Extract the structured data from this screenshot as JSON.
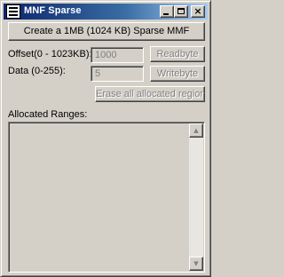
{
  "window": {
    "title": "MNF Sparse",
    "app_icon": "document-icon",
    "controls": {
      "minimize": "minimize-icon",
      "maximize": "maximize-icon",
      "close": "close-icon",
      "close_glyph": "×"
    }
  },
  "buttons": {
    "create_label": "Create a 1MB (1024 KB) Sparse MMF",
    "readbyte_label": "Readbyte",
    "writebyte_label": "Writebyte",
    "erase_label": "Erase all allocated regions"
  },
  "fields": {
    "offset_label": "Offset(0 - 1023KB):",
    "offset_value": "1000",
    "data_label": "Data (0-255):",
    "data_value": "5"
  },
  "ranges": {
    "label": "Allocated Ranges:",
    "items": []
  },
  "scrollbar": {
    "up_glyph": "▲",
    "down_glyph": "▼"
  },
  "colors": {
    "face": "#d4d0c8",
    "title_start": "#0a246a",
    "title_end": "#a6caf0",
    "disabled_text": "#808080"
  }
}
